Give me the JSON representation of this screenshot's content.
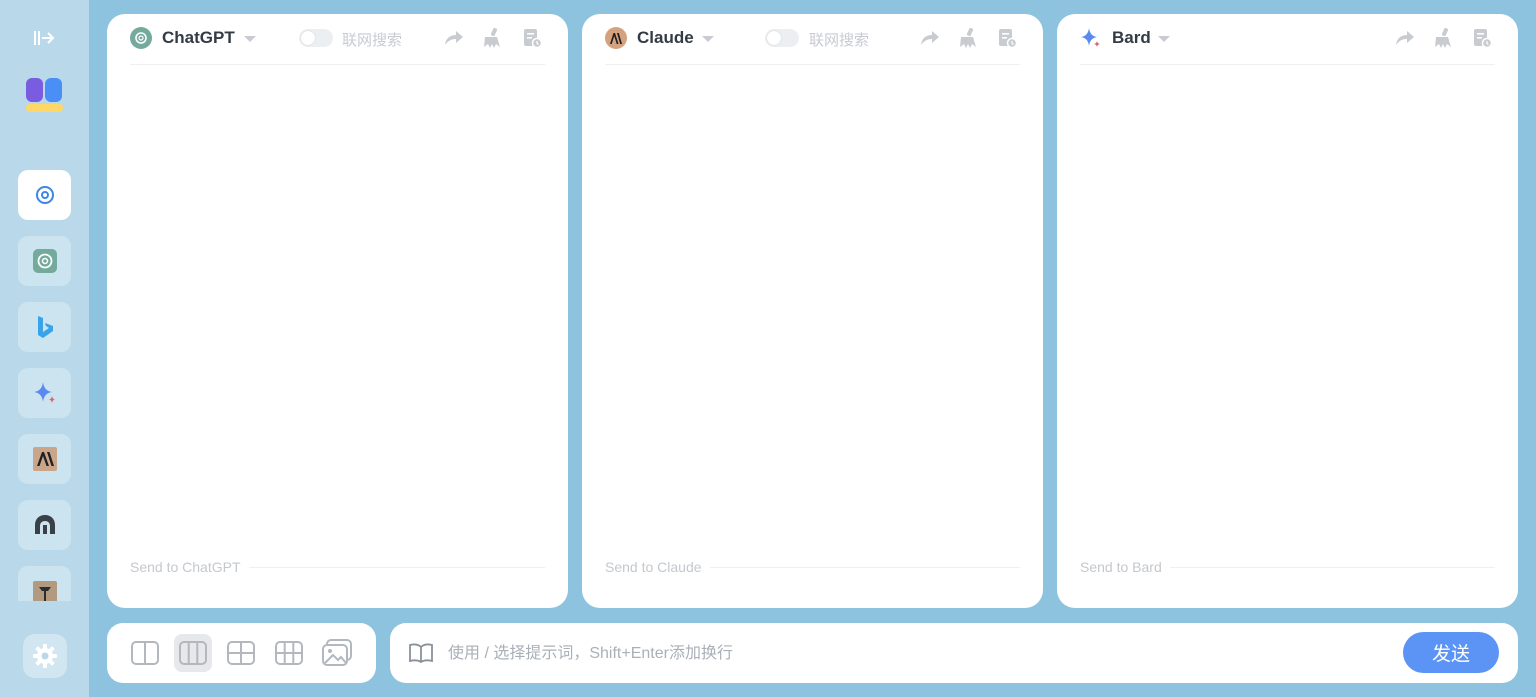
{
  "sidebar": {
    "collapse_icon": "expand-sidebar-icon",
    "logo_icon": "app-logo",
    "items": [
      {
        "name": "multi-chat",
        "icon": "swirl-icon",
        "active": true
      },
      {
        "name": "chatgpt",
        "icon": "openai-icon",
        "active": false
      },
      {
        "name": "bing",
        "icon": "bing-icon",
        "active": false
      },
      {
        "name": "bard",
        "icon": "bard-sparkle-icon",
        "active": false
      },
      {
        "name": "claude",
        "icon": "anthropic-icon",
        "active": false
      },
      {
        "name": "poe",
        "icon": "poe-icon",
        "active": false
      },
      {
        "name": "other",
        "icon": "robot-icon",
        "active": false
      }
    ],
    "settings_icon": "gear-icon"
  },
  "panels": [
    {
      "model": "ChatGPT",
      "icon": "openai-icon",
      "search_toggle_label": "联网搜索",
      "search_enabled": false,
      "send_to": "Send to ChatGPT"
    },
    {
      "model": "Claude",
      "icon": "anthropic-icon",
      "search_toggle_label": "联网搜索",
      "search_enabled": false,
      "send_to": "Send to Claude"
    },
    {
      "model": "Bard",
      "icon": "bard-sparkle-icon",
      "send_to": "Send to Bard"
    }
  ],
  "layout_options": [
    {
      "icon": "two-column-icon",
      "active": false
    },
    {
      "icon": "three-column-icon",
      "active": true
    },
    {
      "icon": "grid-2x2-icon",
      "active": false
    },
    {
      "icon": "grid-2x3-icon",
      "active": false
    },
    {
      "icon": "image-mode-icon",
      "active": false
    }
  ],
  "composer": {
    "placeholder": "使用 / 选择提示词，Shift+Enter添加换行",
    "value": "",
    "send_label": "发送"
  },
  "colors": {
    "background": "#8dc3df",
    "sidebar": "#b9d9ea",
    "accent": "#5b94f5"
  }
}
